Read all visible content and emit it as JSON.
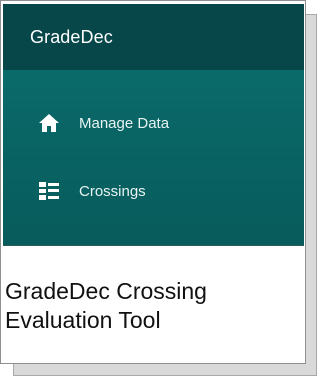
{
  "app": {
    "title": "GradeDec"
  },
  "nav": {
    "items": [
      {
        "label": "Manage Data",
        "icon": "home-icon"
      },
      {
        "label": "Crossings",
        "icon": "list-icon"
      }
    ]
  },
  "caption": {
    "line1": "GradeDec Crossing",
    "line2": "Evaluation Tool"
  },
  "colors": {
    "header_bg": "#07474a",
    "nav_bg": "#0a6a6a",
    "nav_text": "#e9f3f3",
    "caption_text": "#111111"
  }
}
